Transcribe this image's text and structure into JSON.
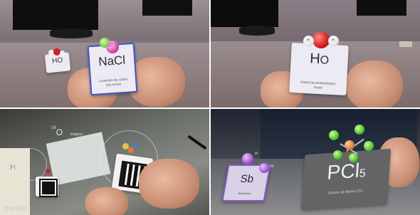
{
  "panel_top_left": {
    "card_big_symbol": "NaCl",
    "card_big_line1": "CLORURO DE SODIO",
    "card_big_line2": "(Sal común)",
    "card_small_symbol": "HO",
    "atom_label_small": "Cl"
  },
  "panel_top_right": {
    "card_symbol_main": "H",
    "card_symbol_sub": "O",
    "card_line1": "ÓXIDO DE DIHIDRÓGENO",
    "card_line2": "(Agua)",
    "atom_label_left": "H",
    "atom_label_right": "H"
  },
  "panel_bottom_left": {
    "isotope_mass": "16",
    "isotope_symbol": "O",
    "isotope_word": "oxígeno",
    "left_book_letter": "H",
    "bottom_word": "metalo"
  },
  "panel_bottom_right": {
    "card_left_symbol": "Sb",
    "card_left_line": "Antimonio",
    "card_right_symbol_main": "PCl",
    "card_right_symbol_sub": "5",
    "card_right_line": "Cloruro de fósforo (V)",
    "atom_label_a": "III",
    "atom_label_b": "III"
  },
  "colors": {
    "sodium_atom": "#7ad64a",
    "chlorine_atom": "#d94aa8",
    "oxygen_atom": "#d21f1f",
    "hydrogen_atom": "#f2f2f2",
    "antimony_atom": "#a35ad6",
    "phosphorus_atom": "#e07a3a",
    "chlorine_green": "#56c234",
    "card_border_blue": "#3d56c9"
  }
}
